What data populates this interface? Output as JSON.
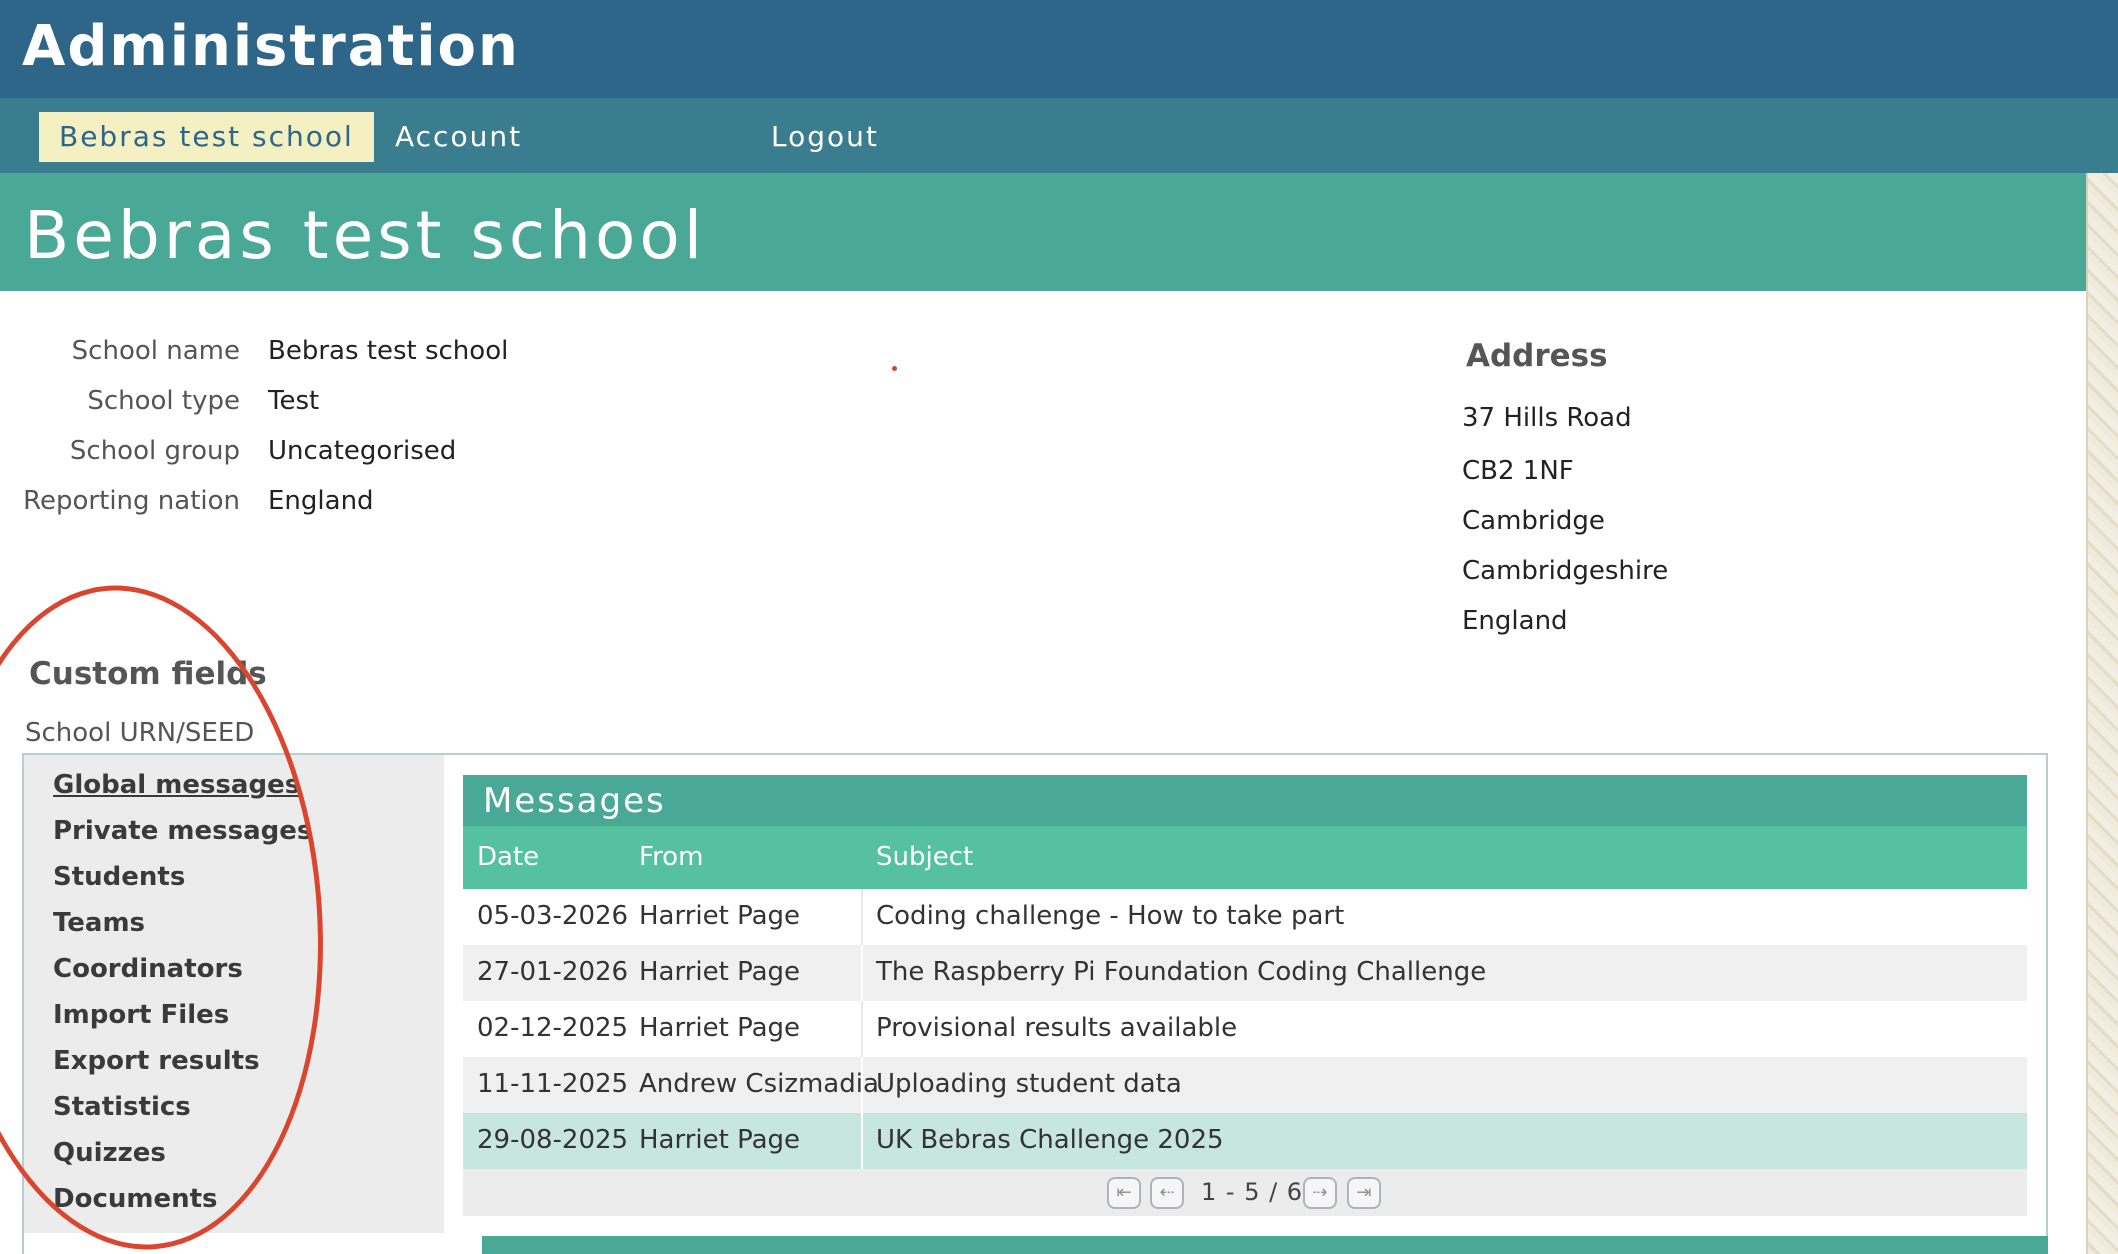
{
  "header": {
    "title": "Administration"
  },
  "nav": [
    {
      "label": "Bebras test school"
    },
    {
      "label": "Account"
    },
    {
      "label": "Logout"
    }
  ],
  "school": {
    "title": "Bebras test school",
    "fields": [
      {
        "label": "School name",
        "value": "Bebras test school"
      },
      {
        "label": "School type",
        "value": "Test"
      },
      {
        "label": "School group",
        "value": "Uncategorised"
      },
      {
        "label": "Reporting nation",
        "value": "England"
      }
    ]
  },
  "address": {
    "title": "Address",
    "lines": [
      "37 Hills Road",
      "CB2 1NF",
      "Cambridge",
      "Cambridgeshire",
      "England"
    ]
  },
  "custom_fields": {
    "title": "Custom fields",
    "items": [
      "School URN/SEED"
    ]
  },
  "sidebar": {
    "items": [
      {
        "label": "Global messages"
      },
      {
        "label": "Private messages"
      },
      {
        "label": "Students"
      },
      {
        "label": "Teams"
      },
      {
        "label": "Coordinators"
      },
      {
        "label": "Import Files"
      },
      {
        "label": "Export results"
      },
      {
        "label": "Statistics"
      },
      {
        "label": "Quizzes"
      },
      {
        "label": "Documents"
      }
    ]
  },
  "messages": {
    "title": "Messages",
    "columns": [
      "Date",
      "From",
      "Subject"
    ],
    "rows": [
      {
        "date": "05-03-2026",
        "from": "Harriet Page",
        "subject": "Coding challenge - How to take part"
      },
      {
        "date": "27-01-2026",
        "from": "Harriet Page",
        "subject": "The Raspberry Pi Foundation Coding Challenge"
      },
      {
        "date": "02-12-2025",
        "from": "Harriet Page",
        "subject": "Provisional results available"
      },
      {
        "date": "11-11-2025",
        "from": "Andrew Csizmadia",
        "subject": "Uploading student data"
      },
      {
        "date": "29-08-2025",
        "from": "Harriet Page",
        "subject": "UK Bebras Challenge 2025"
      }
    ],
    "pager": {
      "text": "1 - 5 / 6"
    }
  },
  "colors": {
    "admin_bar": "#2e6689",
    "nav_bar": "#3a7d8e",
    "school_header": "#4aa896",
    "table_header": "#56c19e",
    "active_nav": "#f4f0c2",
    "annotation": "#d9452f"
  },
  "icons": {
    "pager_first": "first-page-icon",
    "pager_prev": "prev-page-icon",
    "pager_next": "next-page-icon",
    "pager_last": "last-page-icon"
  }
}
